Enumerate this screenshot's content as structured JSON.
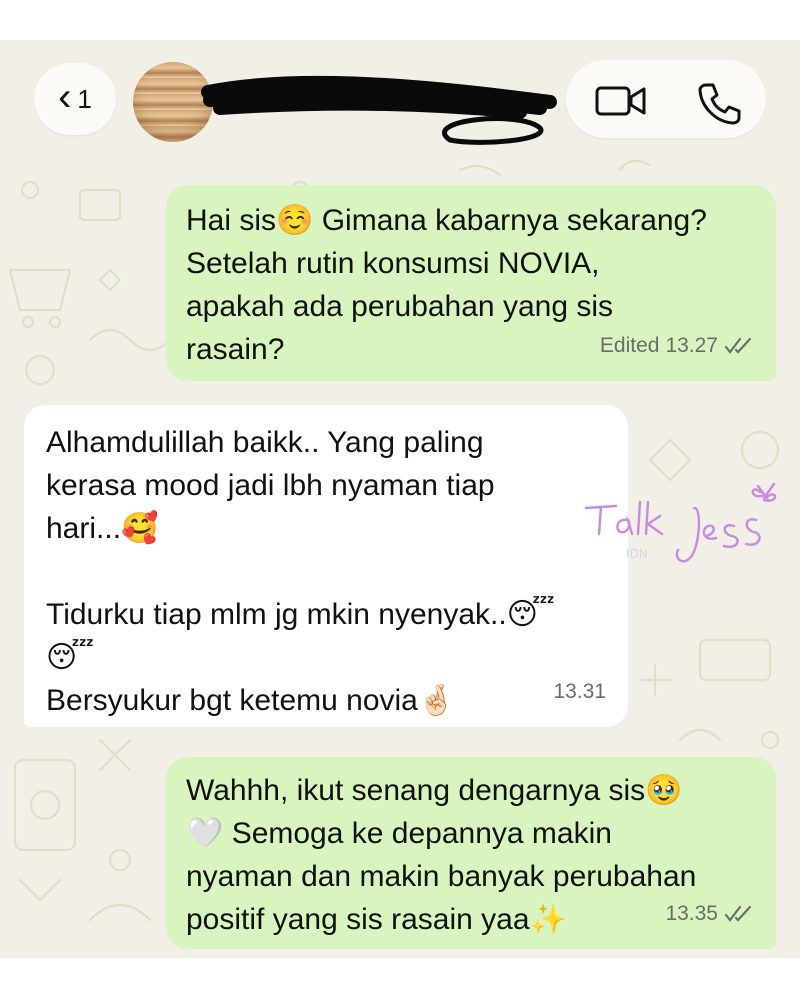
{
  "header": {
    "back_label": "‹",
    "unread_count": "1",
    "icons": {
      "back": "chevron-left-icon",
      "video": "video-call-icon",
      "phone": "phone-call-icon"
    }
  },
  "messages": [
    {
      "direction": "outgoing",
      "text": "Hai sis☺️ Gimana kabarnya sekarang?\nSetelah rutin konsumsi NOVIA,\napakah ada perubahan yang sis\nrasain?",
      "status": "Edited",
      "time": "13.27",
      "ticks": "double-check-icon"
    },
    {
      "direction": "incoming",
      "text": "Alhamdulillah baikk.. Yang paling\nkerasa mood jadi lbh nyaman tiap\nhari...🥰\n\nTidurku tiap mlm jg mkin nyenyak..😴\n😴\nBersyukur bgt ketemu novia🤞🏻",
      "time": "13.31"
    },
    {
      "direction": "outgoing",
      "text": "Wahhh, ikut senang dengarnya sis🥹\n🤍 Semoga ke depannya makin\nnyaman dan makin banyak perubahan\npositif yang sis rasain yaa✨",
      "time": "13.35",
      "ticks": "double-check-icon"
    }
  ],
  "watermark": {
    "text": "Talk Jess"
  },
  "colors": {
    "chat_background": "#f2efe6",
    "outgoing_bubble": "#d8f5c0",
    "incoming_bubble": "#ffffff",
    "watermark": "#c88be0"
  }
}
